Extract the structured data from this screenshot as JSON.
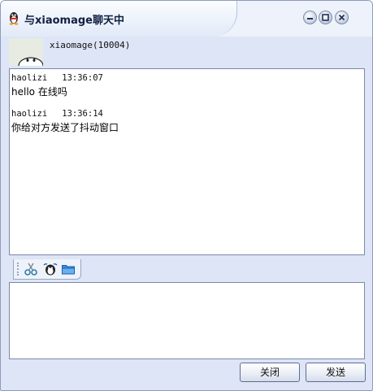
{
  "window": {
    "title": "与xiaomage聊天中"
  },
  "contact": {
    "name": "xiaomage(10004)"
  },
  "messages": [
    {
      "sender": "haolizi",
      "time": "13:36:07",
      "text": "hello 在线吗"
    },
    {
      "sender": "haolizi",
      "time": "13:36:14",
      "text": "你给对方发送了抖动窗口"
    }
  ],
  "toolbar": {
    "tools": [
      "cut-icon",
      "shake-icon",
      "folder-icon"
    ]
  },
  "input": {
    "value": ""
  },
  "buttons": {
    "close": "关闭",
    "send": "发送"
  },
  "colors": {
    "window_bg": "#dde5f6",
    "border": "#7a8aa8"
  }
}
